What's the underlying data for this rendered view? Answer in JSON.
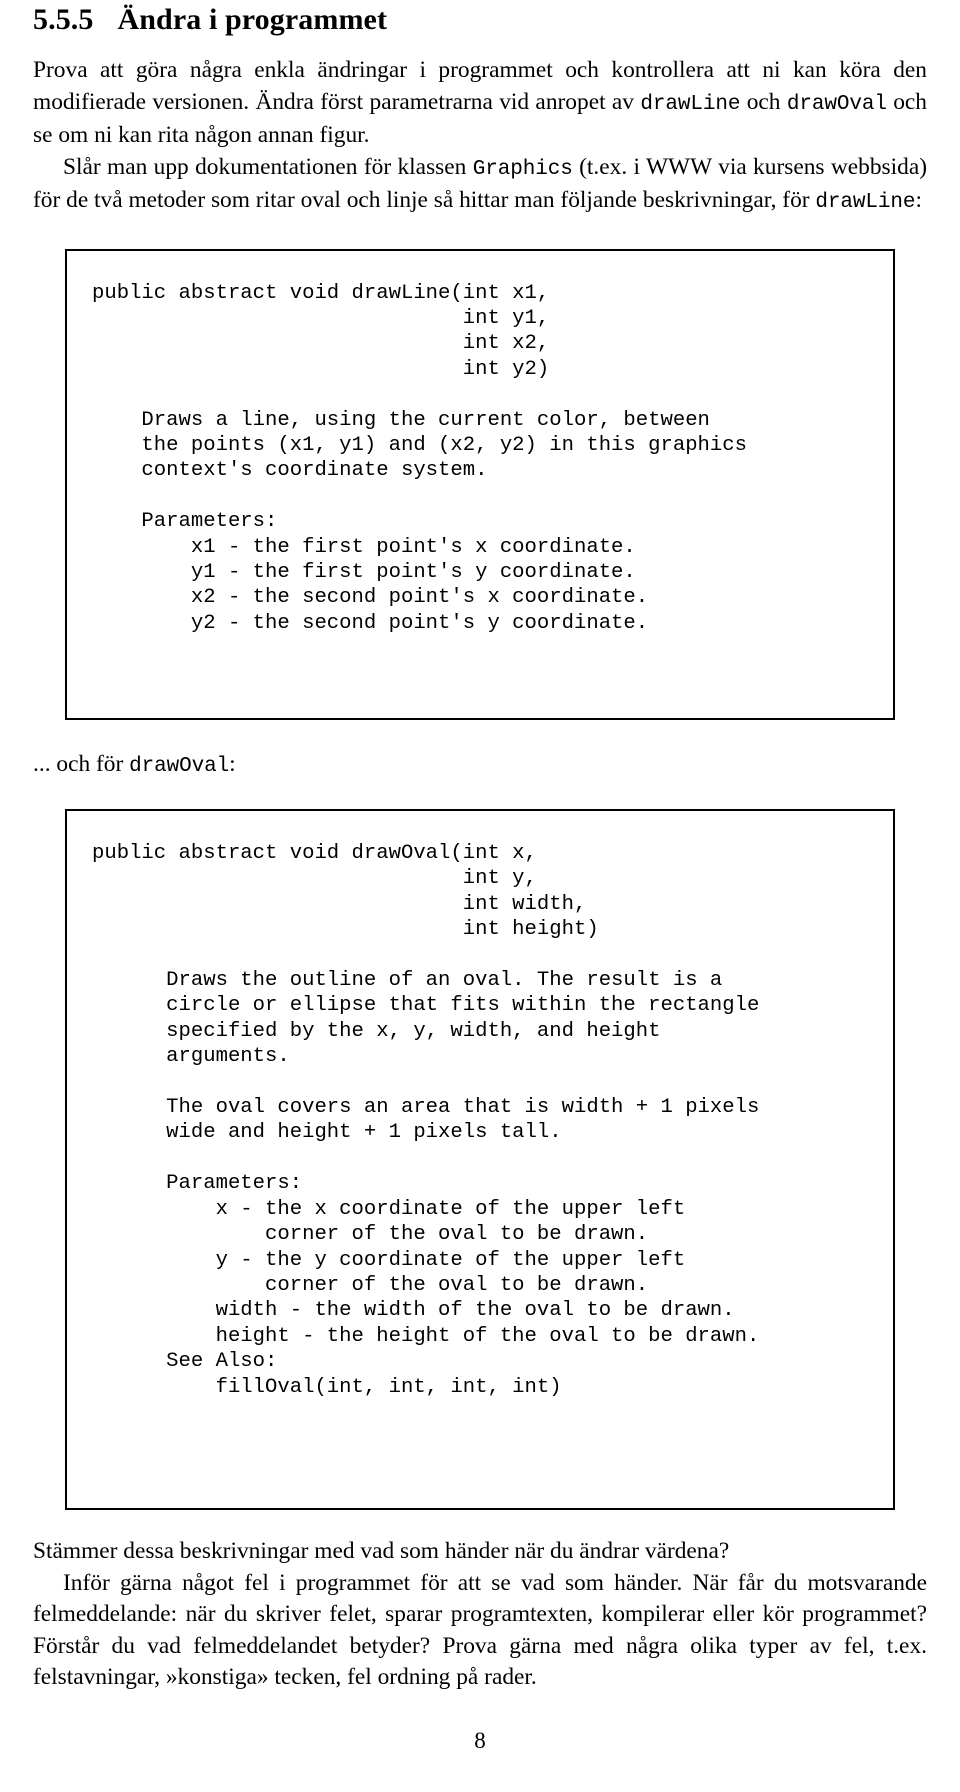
{
  "heading": {
    "number": "5.5.5",
    "title": "Ändra i programmet"
  },
  "intro": {
    "paragraph1_part1": "Prova att göra några enkla ändringar i programmet och kontrollera att ni kan köra den modifierade versionen. Ändra först parametrarna vid anropet av ",
    "code_drawline": "drawLine",
    "paragraph1_part2": " och ",
    "code_drawoval": "drawOval",
    "paragraph1_part3": " och se om ni kan rita någon annan figur.",
    "paragraph2_part1": "Slår man upp dokumentationen för klassen ",
    "code_graphics": "Graphics",
    "paragraph2_part2": " (t.ex. i WWW via kursens webbsida) för de två metoder som ritar oval och linje så hittar man följande beskrivningar, för ",
    "code_drawline2": "drawLine",
    "paragraph2_part3": ":"
  },
  "interlude": {
    "prefix": "... och för ",
    "code_drawoval": "drawOval",
    "suffix": ":"
  },
  "code_boxes": {
    "drawline": "public abstract void drawLine(int x1,\n                              int y1,\n                              int x2,\n                              int y2)\n\n    Draws a line, using the current color, between\n    the points (x1, y1) and (x2, y2) in this graphics\n    context's coordinate system.\n\n    Parameters:\n        x1 - the first point's x coordinate.\n        y1 - the first point's y coordinate.\n        x2 - the second point's x coordinate.\n        y2 - the second point's y coordinate.",
    "drawoval": "public abstract void drawOval(int x,\n                              int y,\n                              int width,\n                              int height)\n\n      Draws the outline of an oval. The result is a\n      circle or ellipse that fits within the rectangle\n      specified by the x, y, width, and height\n      arguments.\n\n      The oval covers an area that is width + 1 pixels\n      wide and height + 1 pixels tall.\n\n      Parameters:\n          x - the x coordinate of the upper left\n              corner of the oval to be drawn.\n          y - the y coordinate of the upper left\n              corner of the oval to be drawn.\n          width - the width of the oval to be drawn.\n          height - the height of the oval to be drawn.\n      See Also:\n          fillOval(int, int, int, int)"
  },
  "closing": {
    "paragraph1": "Stämmer dessa beskrivningar med vad som händer när du ändrar värdena?",
    "paragraph2": "Inför gärna något fel i programmet för att se vad som händer. När får du motsvarande felmeddelande: när du skriver felet, sparar programtexten, kompilerar eller kör programmet? Förstår du vad felmeddelandet betyder? Prova gärna med några olika typer av fel, t.ex. felstavningar, »konstiga» tecken, fel ordning på rader."
  },
  "footer": {
    "page_number": "8"
  }
}
